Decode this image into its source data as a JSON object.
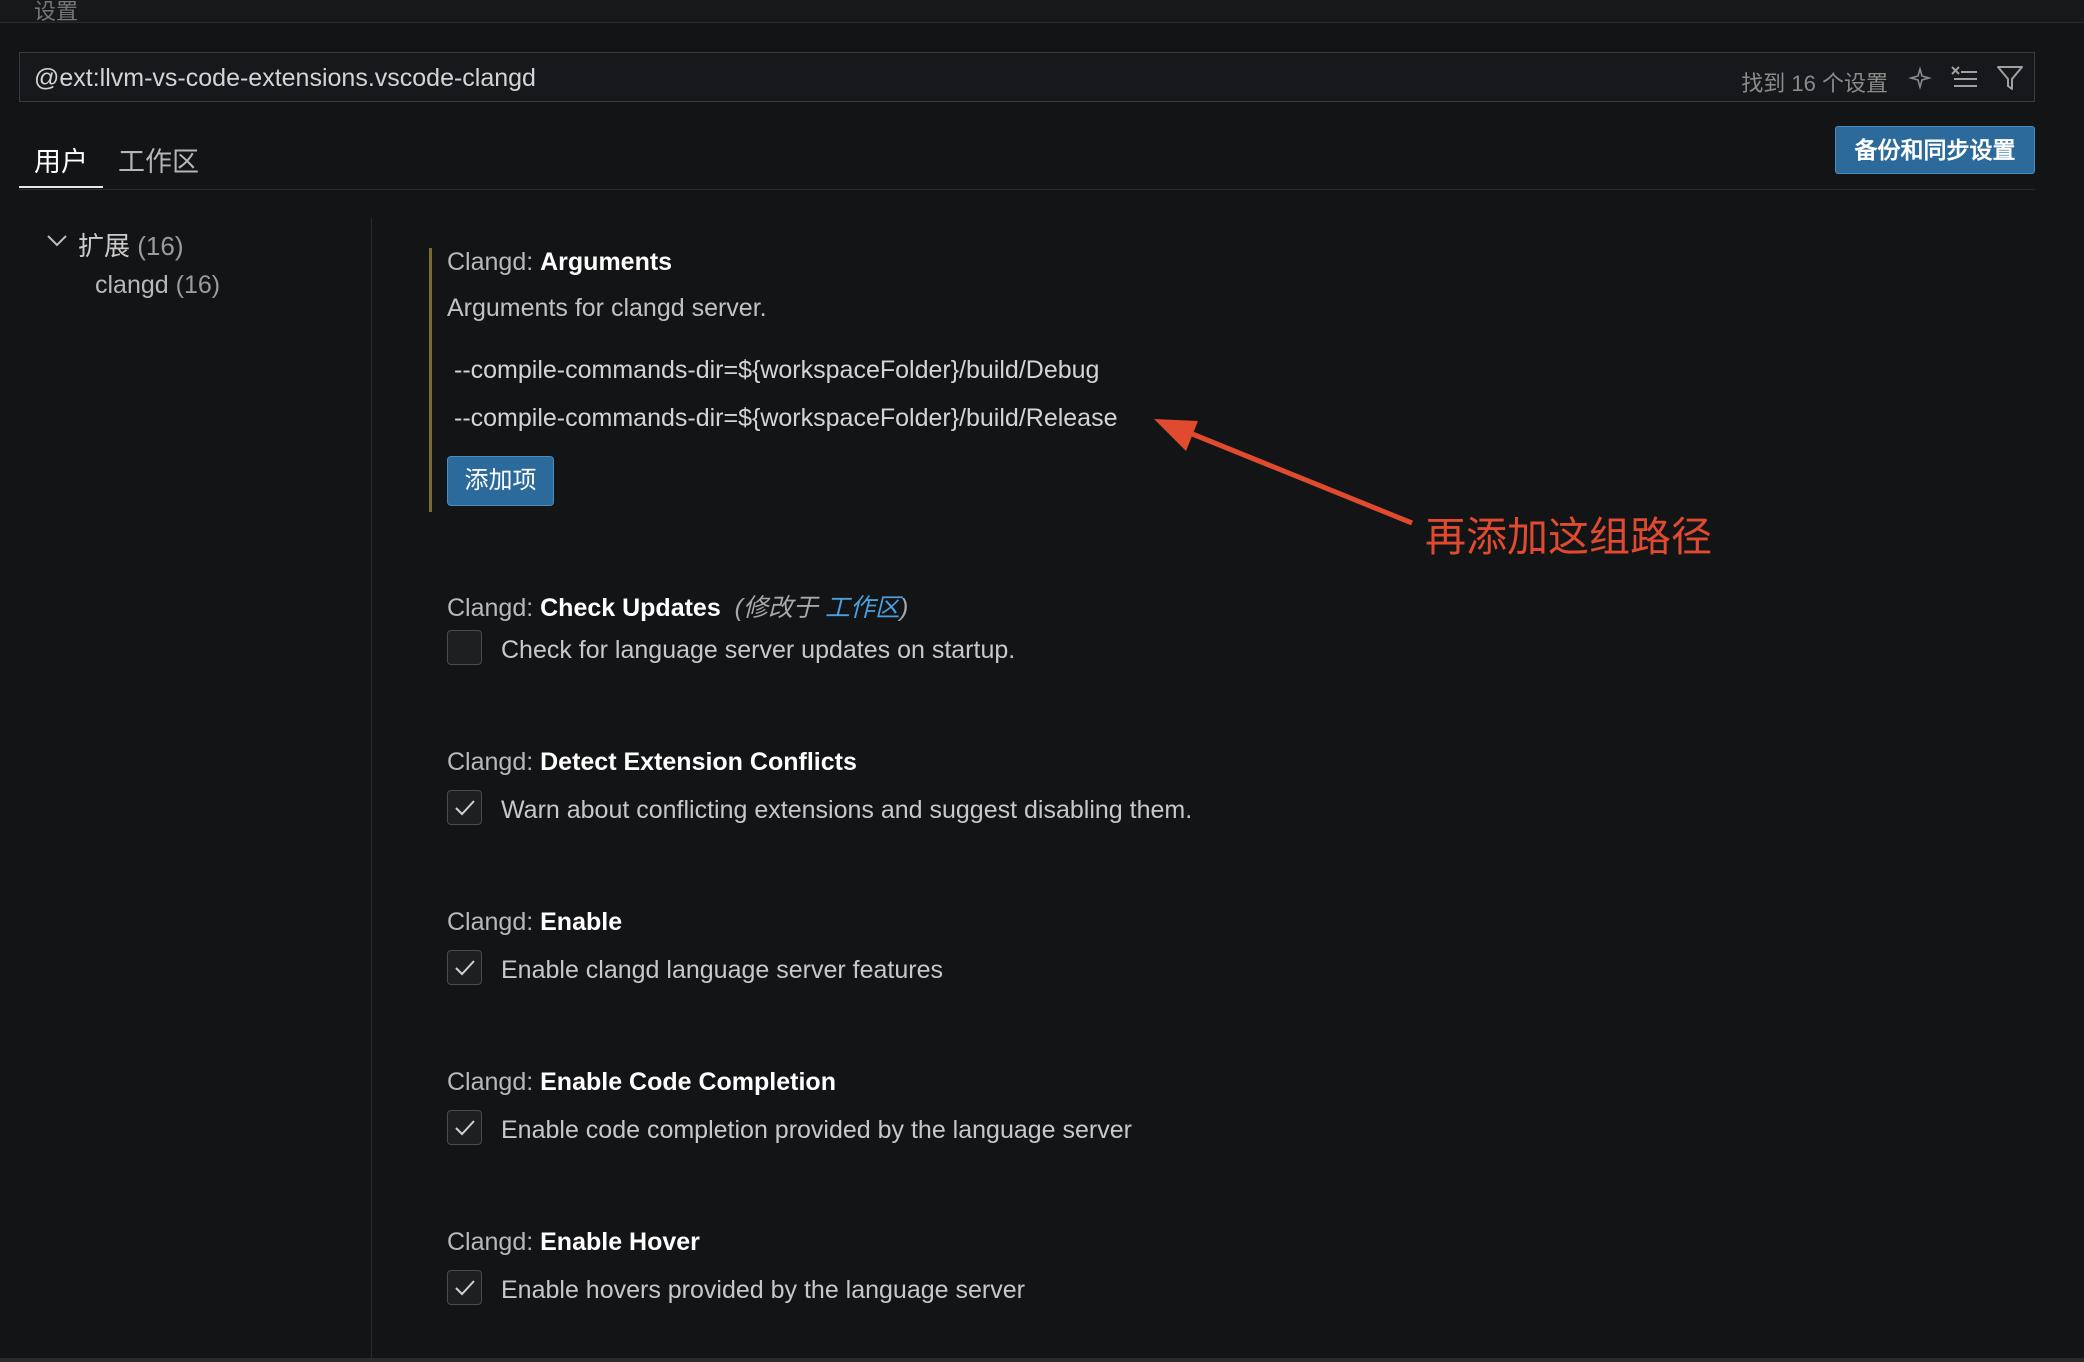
{
  "header": {
    "window_title": "设置"
  },
  "search": {
    "value": "@ext:llvm-vs-code-extensions.vscode-clangd",
    "result_count": "找到 16 个设置"
  },
  "tabs": [
    {
      "label": "用户",
      "active": true
    },
    {
      "label": "工作区",
      "active": false
    }
  ],
  "sync_button": "备份和同步设置",
  "tree": {
    "extensions_label": "扩展",
    "extensions_count": "(16)",
    "clangd_label": "clangd",
    "clangd_count": "(16)"
  },
  "settings": {
    "arguments": {
      "category": "Clangd: ",
      "name": "Arguments",
      "description": "Arguments for clangd server.",
      "items": [
        "--compile-commands-dir=${workspaceFolder}/build/Debug",
        "--compile-commands-dir=${workspaceFolder}/build/Release"
      ],
      "add_button": "添加项"
    },
    "check_updates": {
      "category": "Clangd: ",
      "name": "Check Updates",
      "modified_prefix": "(修改于 ",
      "modified_link": "工作区",
      "modified_suffix": ")",
      "label": "Check for language server updates on startup.",
      "checked": false
    },
    "detect_conflicts": {
      "category": "Clangd: ",
      "name": "Detect Extension Conflicts",
      "label": "Warn about conflicting extensions and suggest disabling them.",
      "checked": true
    },
    "enable": {
      "category": "Clangd: ",
      "name": "Enable",
      "label": "Enable clangd language server features",
      "checked": true
    },
    "enable_code_completion": {
      "category": "Clangd: ",
      "name": "Enable Code Completion",
      "label": "Enable code completion provided by the language server",
      "checked": true
    },
    "enable_hover": {
      "category": "Clangd: ",
      "name": "Enable Hover",
      "label": "Enable hovers provided by the language server",
      "checked": true
    }
  },
  "annotation": {
    "text": "再添加这组路径",
    "color": "#e04a2f"
  },
  "colors": {
    "background": "#131416",
    "accent_button": "#2b6a9a",
    "link": "#4a9fdc",
    "modified_indicator": "#7a6a33"
  }
}
